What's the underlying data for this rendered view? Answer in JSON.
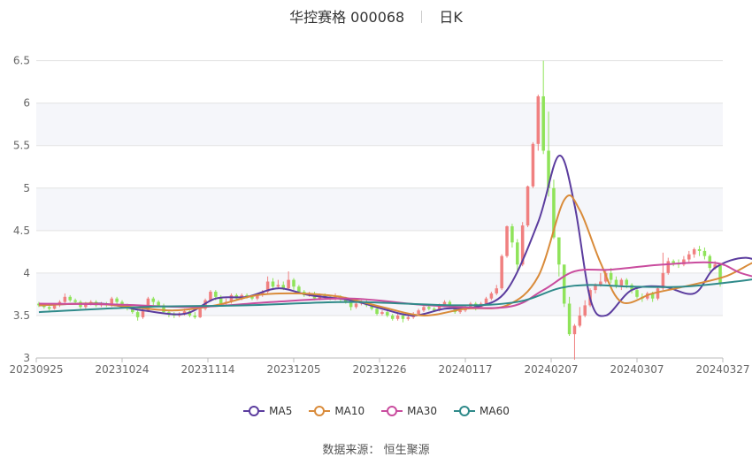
{
  "header": {
    "stock_title": "华控赛格 000068",
    "period": "日K"
  },
  "source": {
    "label": "数据来源：",
    "value": "恒生聚源"
  },
  "chart_data": {
    "type": "candlestick",
    "x_ticks": [
      "20230925",
      "20231024",
      "20231114",
      "20231205",
      "20231226",
      "20240117",
      "20240207",
      "20240307",
      "20240327"
    ],
    "y_ticks": [
      3,
      3.5,
      4,
      4.5,
      5,
      5.5,
      6,
      6.5
    ],
    "ylim": [
      3,
      6.6
    ],
    "grid": true,
    "legend_position": "bottom",
    "up_color": "#f08080",
    "down_color": "#8fe35a",
    "legend": [
      {
        "name": "MA5",
        "color": "#5b3c9e"
      },
      {
        "name": "MA10",
        "color": "#d98b3a"
      },
      {
        "name": "MA30",
        "color": "#c94c9e"
      },
      {
        "name": "MA60",
        "color": "#2f8a8a"
      }
    ],
    "candles": [
      [
        3.64,
        3.62,
        3.66,
        3.6
      ],
      [
        3.62,
        3.6,
        3.64,
        3.58
      ],
      [
        3.6,
        3.58,
        3.62,
        3.56
      ],
      [
        3.58,
        3.62,
        3.64,
        3.57
      ],
      [
        3.62,
        3.66,
        3.68,
        3.6
      ],
      [
        3.66,
        3.72,
        3.76,
        3.64
      ],
      [
        3.72,
        3.68,
        3.74,
        3.66
      ],
      [
        3.68,
        3.66,
        3.7,
        3.64
      ],
      [
        3.66,
        3.6,
        3.68,
        3.58
      ],
      [
        3.6,
        3.64,
        3.66,
        3.58
      ],
      [
        3.64,
        3.66,
        3.68,
        3.62
      ],
      [
        3.66,
        3.62,
        3.68,
        3.6
      ],
      [
        3.62,
        3.64,
        3.66,
        3.6
      ],
      [
        3.64,
        3.62,
        3.66,
        3.6
      ],
      [
        3.62,
        3.7,
        3.72,
        3.6
      ],
      [
        3.7,
        3.66,
        3.72,
        3.64
      ],
      [
        3.66,
        3.62,
        3.68,
        3.6
      ],
      [
        3.62,
        3.58,
        3.64,
        3.56
      ],
      [
        3.58,
        3.54,
        3.6,
        3.52
      ],
      [
        3.54,
        3.48,
        3.56,
        3.44
      ],
      [
        3.48,
        3.55,
        3.58,
        3.46
      ],
      [
        3.55,
        3.7,
        3.72,
        3.54
      ],
      [
        3.7,
        3.66,
        3.72,
        3.62
      ],
      [
        3.66,
        3.62,
        3.68,
        3.6
      ],
      [
        3.62,
        3.54,
        3.64,
        3.52
      ],
      [
        3.54,
        3.52,
        3.56,
        3.48
      ],
      [
        3.52,
        3.5,
        3.54,
        3.47
      ],
      [
        3.5,
        3.52,
        3.54,
        3.48
      ],
      [
        3.52,
        3.55,
        3.58,
        3.5
      ],
      [
        3.55,
        3.5,
        3.56,
        3.48
      ],
      [
        3.5,
        3.48,
        3.54,
        3.46
      ],
      [
        3.48,
        3.58,
        3.6,
        3.47
      ],
      [
        3.58,
        3.68,
        3.7,
        3.56
      ],
      [
        3.68,
        3.78,
        3.8,
        3.66
      ],
      [
        3.78,
        3.72,
        3.8,
        3.68
      ],
      [
        3.72,
        3.64,
        3.74,
        3.62
      ],
      [
        3.64,
        3.66,
        3.7,
        3.62
      ],
      [
        3.66,
        3.74,
        3.76,
        3.64
      ],
      [
        3.74,
        3.7,
        3.76,
        3.68
      ],
      [
        3.7,
        3.74,
        3.76,
        3.68
      ],
      [
        3.74,
        3.72,
        3.76,
        3.7
      ],
      [
        3.72,
        3.7,
        3.74,
        3.68
      ],
      [
        3.7,
        3.74,
        3.76,
        3.68
      ],
      [
        3.74,
        3.78,
        3.8,
        3.72
      ],
      [
        3.78,
        3.9,
        3.96,
        3.76
      ],
      [
        3.9,
        3.84,
        3.94,
        3.8
      ],
      [
        3.84,
        3.86,
        3.92,
        3.82
      ],
      [
        3.86,
        3.82,
        3.9,
        3.8
      ],
      [
        3.82,
        3.92,
        4.02,
        3.8
      ],
      [
        3.92,
        3.84,
        3.94,
        3.8
      ],
      [
        3.84,
        3.78,
        3.86,
        3.76
      ],
      [
        3.78,
        3.74,
        3.8,
        3.72
      ],
      [
        3.74,
        3.76,
        3.78,
        3.72
      ],
      [
        3.76,
        3.7,
        3.78,
        3.68
      ],
      [
        3.7,
        3.74,
        3.76,
        3.68
      ],
      [
        3.74,
        3.72,
        3.76,
        3.7
      ],
      [
        3.72,
        3.7,
        3.74,
        3.68
      ],
      [
        3.7,
        3.72,
        3.76,
        3.68
      ],
      [
        3.72,
        3.7,
        3.74,
        3.66
      ],
      [
        3.7,
        3.66,
        3.72,
        3.64
      ],
      [
        3.66,
        3.6,
        3.68,
        3.56
      ],
      [
        3.6,
        3.64,
        3.66,
        3.58
      ],
      [
        3.64,
        3.66,
        3.68,
        3.62
      ],
      [
        3.66,
        3.62,
        3.68,
        3.6
      ],
      [
        3.62,
        3.58,
        3.64,
        3.56
      ],
      [
        3.58,
        3.52,
        3.6,
        3.5
      ],
      [
        3.52,
        3.54,
        3.56,
        3.5
      ],
      [
        3.54,
        3.5,
        3.56,
        3.48
      ],
      [
        3.5,
        3.46,
        3.52,
        3.44
      ],
      [
        3.46,
        3.5,
        3.52,
        3.44
      ],
      [
        3.5,
        3.46,
        3.52,
        3.42
      ],
      [
        3.46,
        3.48,
        3.5,
        3.44
      ],
      [
        3.48,
        3.52,
        3.54,
        3.46
      ],
      [
        3.52,
        3.56,
        3.58,
        3.5
      ],
      [
        3.56,
        3.6,
        3.62,
        3.54
      ],
      [
        3.6,
        3.58,
        3.62,
        3.56
      ],
      [
        3.58,
        3.56,
        3.6,
        3.54
      ],
      [
        3.56,
        3.62,
        3.64,
        3.55
      ],
      [
        3.62,
        3.66,
        3.68,
        3.6
      ],
      [
        3.66,
        3.6,
        3.68,
        3.58
      ],
      [
        3.6,
        3.54,
        3.62,
        3.52
      ],
      [
        3.54,
        3.56,
        3.58,
        3.52
      ],
      [
        3.56,
        3.6,
        3.62,
        3.54
      ],
      [
        3.6,
        3.64,
        3.66,
        3.58
      ],
      [
        3.64,
        3.6,
        3.66,
        3.56
      ],
      [
        3.6,
        3.64,
        3.66,
        3.58
      ],
      [
        3.64,
        3.7,
        3.72,
        3.62
      ],
      [
        3.7,
        3.76,
        3.78,
        3.68
      ],
      [
        3.76,
        3.82,
        3.86,
        3.74
      ],
      [
        3.82,
        4.2,
        4.22,
        3.8
      ],
      [
        4.2,
        4.55,
        4.56,
        4.18
      ],
      [
        4.55,
        4.36,
        4.58,
        4.3
      ],
      [
        4.36,
        4.1,
        4.4,
        4.02
      ],
      [
        4.1,
        4.56,
        4.6,
        4.08
      ],
      [
        4.56,
        5.02,
        5.03,
        4.54
      ],
      [
        5.02,
        5.52,
        5.54,
        5.0
      ],
      [
        5.52,
        6.08,
        6.1,
        5.44
      ],
      [
        6.08,
        5.44,
        6.5,
        5.4
      ],
      [
        5.44,
        5.0,
        5.9,
        4.9
      ],
      [
        5.0,
        4.42,
        5.1,
        4.4
      ],
      [
        4.42,
        4.1,
        4.22,
        3.96
      ],
      [
        4.1,
        3.64,
        3.8,
        3.6
      ],
      [
        3.64,
        3.28,
        3.72,
        3.26
      ],
      [
        3.28,
        3.38,
        3.4,
        2.98
      ],
      [
        3.38,
        3.5,
        3.6,
        3.36
      ],
      [
        3.5,
        3.62,
        3.68,
        3.48
      ],
      [
        3.62,
        3.8,
        3.82,
        3.6
      ],
      [
        3.8,
        3.86,
        3.88,
        3.76
      ],
      [
        3.86,
        3.9,
        4.0,
        3.84
      ],
      [
        3.9,
        4.0,
        4.04,
        3.88
      ],
      [
        4.0,
        3.92,
        4.06,
        3.88
      ],
      [
        3.92,
        3.84,
        3.96,
        3.82
      ],
      [
        3.84,
        3.92,
        3.94,
        3.8
      ],
      [
        3.92,
        3.86,
        3.94,
        3.82
      ],
      [
        3.86,
        3.8,
        3.88,
        3.76
      ],
      [
        3.8,
        3.72,
        3.84,
        3.7
      ],
      [
        3.72,
        3.7,
        3.76,
        3.66
      ],
      [
        3.7,
        3.76,
        3.78,
        3.68
      ],
      [
        3.76,
        3.7,
        3.78,
        3.66
      ],
      [
        3.7,
        3.82,
        3.84,
        3.68
      ],
      [
        3.82,
        4.0,
        4.24,
        3.8
      ],
      [
        4.0,
        4.14,
        4.18,
        3.98
      ],
      [
        4.14,
        4.12,
        4.16,
        4.08
      ],
      [
        4.12,
        4.1,
        4.16,
        4.06
      ],
      [
        4.1,
        4.16,
        4.2,
        4.08
      ],
      [
        4.16,
        4.22,
        4.26,
        4.12
      ],
      [
        4.22,
        4.28,
        4.3,
        4.18
      ],
      [
        4.28,
        4.26,
        4.32,
        4.2
      ],
      [
        4.26,
        4.2,
        4.3,
        4.16
      ],
      [
        4.2,
        4.06,
        4.22,
        4.02
      ],
      [
        4.06,
        4.1,
        4.14,
        4.04
      ],
      [
        4.1,
        3.88,
        4.1,
        3.84
      ]
    ],
    "ma": {
      "MA5": [
        [
          0,
          3.62
        ],
        [
          12,
          3.64
        ],
        [
          20,
          3.56
        ],
        [
          28,
          3.52
        ],
        [
          34,
          3.7
        ],
        [
          40,
          3.72
        ],
        [
          46,
          3.82
        ],
        [
          52,
          3.74
        ],
        [
          60,
          3.68
        ],
        [
          66,
          3.58
        ],
        [
          72,
          3.5
        ],
        [
          78,
          3.58
        ],
        [
          84,
          3.6
        ],
        [
          90,
          3.8
        ],
        [
          96,
          4.6
        ],
        [
          100,
          5.38
        ],
        [
          103,
          4.8
        ],
        [
          106,
          3.7
        ],
        [
          109,
          3.5
        ],
        [
          114,
          3.8
        ],
        [
          120,
          3.84
        ],
        [
          126,
          3.76
        ],
        [
          130,
          4.06
        ],
        [
          136,
          4.18
        ],
        [
          141,
          4.04
        ]
      ],
      "MA10": [
        [
          0,
          3.62
        ],
        [
          10,
          3.64
        ],
        [
          18,
          3.6
        ],
        [
          26,
          3.56
        ],
        [
          34,
          3.62
        ],
        [
          42,
          3.74
        ],
        [
          50,
          3.76
        ],
        [
          58,
          3.72
        ],
        [
          66,
          3.6
        ],
        [
          74,
          3.5
        ],
        [
          82,
          3.58
        ],
        [
          90,
          3.62
        ],
        [
          96,
          3.96
        ],
        [
          101,
          4.86
        ],
        [
          104,
          4.74
        ],
        [
          108,
          4.12
        ],
        [
          112,
          3.66
        ],
        [
          118,
          3.76
        ],
        [
          124,
          3.84
        ],
        [
          132,
          3.96
        ],
        [
          138,
          4.14
        ],
        [
          141,
          4.12
        ]
      ],
      "MA30": [
        [
          0,
          3.64
        ],
        [
          15,
          3.63
        ],
        [
          30,
          3.6
        ],
        [
          45,
          3.66
        ],
        [
          60,
          3.7
        ],
        [
          75,
          3.62
        ],
        [
          90,
          3.6
        ],
        [
          97,
          3.8
        ],
        [
          103,
          4.02
        ],
        [
          110,
          4.04
        ],
        [
          120,
          4.1
        ],
        [
          130,
          4.12
        ],
        [
          135,
          4.0
        ],
        [
          141,
          3.9
        ]
      ],
      "MA60": [
        [
          0,
          3.54
        ],
        [
          20,
          3.6
        ],
        [
          40,
          3.62
        ],
        [
          60,
          3.66
        ],
        [
          80,
          3.62
        ],
        [
          92,
          3.66
        ],
        [
          100,
          3.82
        ],
        [
          106,
          3.86
        ],
        [
          114,
          3.84
        ],
        [
          124,
          3.84
        ],
        [
          134,
          3.9
        ],
        [
          141,
          3.96
        ]
      ]
    }
  }
}
